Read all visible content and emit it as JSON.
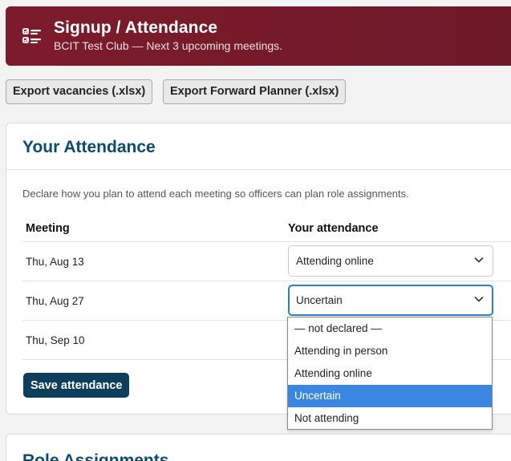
{
  "header": {
    "title": "Signup / Attendance",
    "subtitle": "BCIT Test Club — Next 3 upcoming meetings.",
    "icon": "checklist-icon",
    "bg_color": "#7a1a2a"
  },
  "toolbar": {
    "export_vacancies": "Export vacancies (.xlsx)",
    "export_planner": "Export Forward Planner (.xlsx)"
  },
  "attendance": {
    "title": "Your Attendance",
    "description": "Declare how you plan to attend each meeting so officers can plan role assignments.",
    "col_meeting": "Meeting",
    "col_attendance": "Your attendance",
    "rows": [
      {
        "meeting": "Thu, Aug 13",
        "attendance": "Attending online"
      },
      {
        "meeting": "Thu, Aug 27",
        "attendance": "Uncertain"
      },
      {
        "meeting": "Thu, Sep 10",
        "attendance": ""
      }
    ],
    "save_label": "Save attendance",
    "title_color": "#0d4b6e"
  },
  "dropdown": {
    "options": [
      "— not declared —",
      "Attending in person",
      "Attending online",
      "Uncertain",
      "Not attending"
    ],
    "selected_index": 3,
    "highlight_color": "#3b86e0"
  },
  "roles": {
    "title": "Role Assignments"
  }
}
